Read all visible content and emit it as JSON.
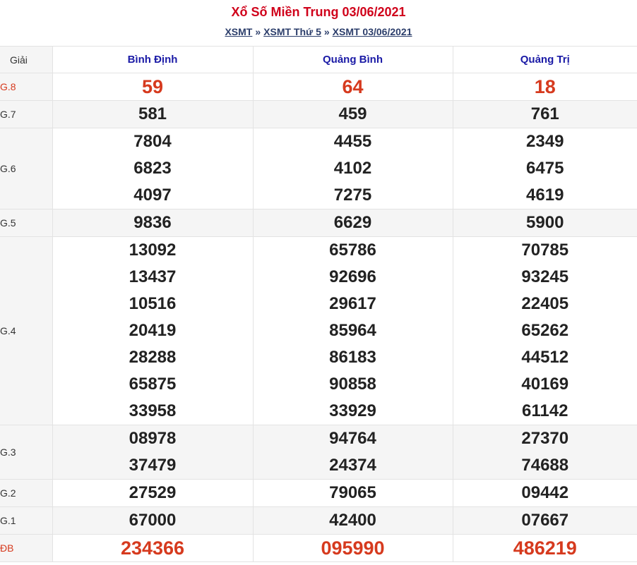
{
  "header": {
    "title": "Xổ Số Miền Trung 03/06/2021",
    "breadcrumb": [
      {
        "label": "XSMT"
      },
      {
        "label": "XSMT Thứ 5"
      },
      {
        "label": "XSMT 03/06/2021"
      }
    ],
    "separator": "»"
  },
  "table": {
    "giai_header": "Giải",
    "provinces": [
      "Bình Định",
      "Quảng Bình",
      "Quảng Trị"
    ],
    "rows": [
      {
        "label": "G.8",
        "style": "red",
        "values": [
          [
            "59"
          ],
          [
            "64"
          ],
          [
            "18"
          ]
        ]
      },
      {
        "label": "G.7",
        "style": "alt",
        "values": [
          [
            "581"
          ],
          [
            "459"
          ],
          [
            "761"
          ]
        ]
      },
      {
        "label": "G.6",
        "style": "",
        "values": [
          [
            "7804",
            "6823",
            "4097"
          ],
          [
            "4455",
            "4102",
            "7275"
          ],
          [
            "2349",
            "6475",
            "4619"
          ]
        ]
      },
      {
        "label": "G.5",
        "style": "alt",
        "values": [
          [
            "9836"
          ],
          [
            "6629"
          ],
          [
            "5900"
          ]
        ]
      },
      {
        "label": "G.4",
        "style": "",
        "values": [
          [
            "13092",
            "13437",
            "10516",
            "20419",
            "28288",
            "65875",
            "33958"
          ],
          [
            "65786",
            "92696",
            "29617",
            "85964",
            "86183",
            "90858",
            "33929"
          ],
          [
            "70785",
            "93245",
            "22405",
            "65262",
            "44512",
            "40169",
            "61142"
          ]
        ]
      },
      {
        "label": "G.3",
        "style": "alt",
        "values": [
          [
            "08978",
            "37479"
          ],
          [
            "94764",
            "24374"
          ],
          [
            "27370",
            "74688"
          ]
        ]
      },
      {
        "label": "G.2",
        "style": "",
        "values": [
          [
            "27529"
          ],
          [
            "79065"
          ],
          [
            "09442"
          ]
        ]
      },
      {
        "label": "G.1",
        "style": "alt",
        "values": [
          [
            "67000"
          ],
          [
            "42400"
          ],
          [
            "07667"
          ]
        ]
      },
      {
        "label": "ĐB",
        "style": "red",
        "values": [
          [
            "234366"
          ],
          [
            "095990"
          ],
          [
            "486219"
          ]
        ]
      }
    ]
  },
  "colors": {
    "title": "#d0021b",
    "province_header": "#1a1aa6",
    "special_prize": "#d63a1e",
    "alt_row_bg": "#f5f5f5"
  }
}
